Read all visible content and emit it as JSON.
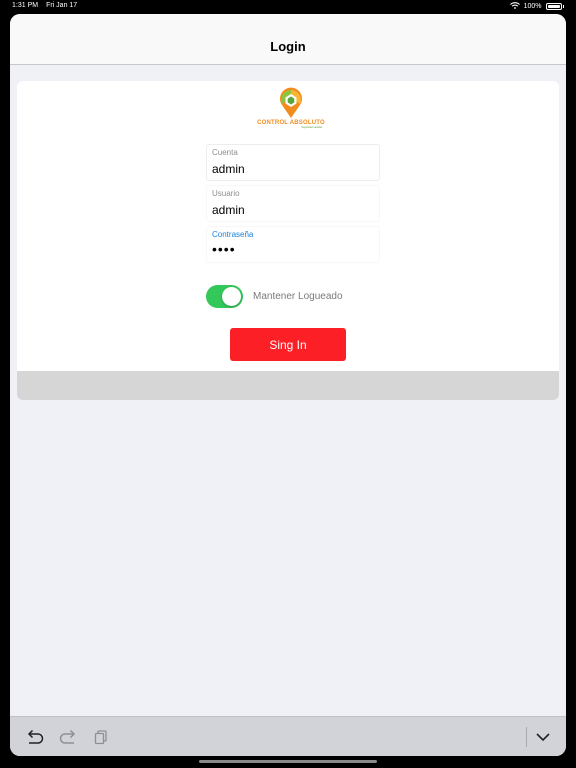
{
  "status_bar": {
    "time": "1:31 PM",
    "date": "Fri Jan 17",
    "battery": "100%",
    "icons": [
      "wifi-icon",
      "battery-icon"
    ]
  },
  "nav": {
    "title": "Login"
  },
  "logo": {
    "name": "CONTROL ABSOLUTO",
    "tagline": "Seguridad satelital"
  },
  "form": {
    "account": {
      "label": "Cuenta",
      "value": "admin"
    },
    "user": {
      "label": "Usuario",
      "value": "admin"
    },
    "password": {
      "label": "Contraseña",
      "value": "••••"
    }
  },
  "remember": {
    "label": "Mantener Logueado",
    "on": true
  },
  "signin_button": {
    "label": "Sing In"
  },
  "keyboard_bar": {
    "icons": [
      "undo-icon",
      "redo-icon",
      "paste-icon",
      "chevron-down-icon"
    ]
  },
  "colors": {
    "accent": "#fc1f26",
    "toggle_on": "#34c759",
    "focused_label": "#1a82d8",
    "logo_orange": "#f28c1e",
    "logo_green": "#5aa33d"
  }
}
